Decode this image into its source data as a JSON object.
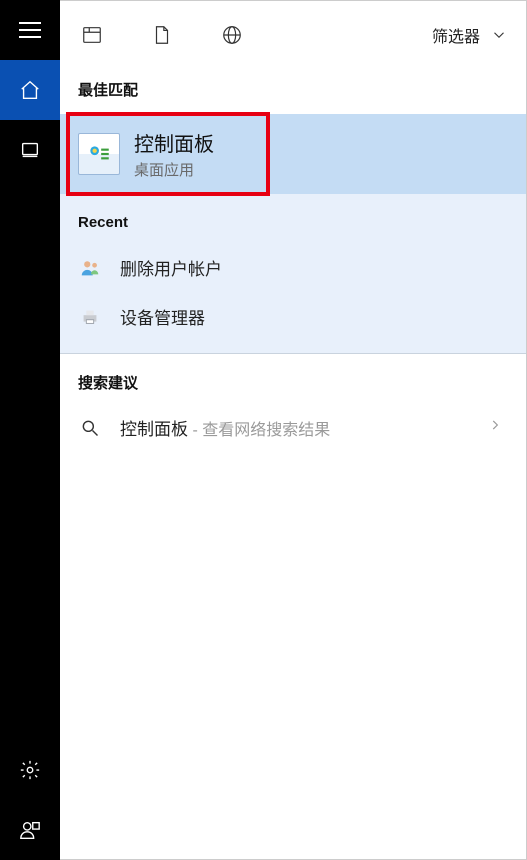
{
  "header": {
    "filter_label": "筛选器"
  },
  "sections": {
    "best_match_title": "最佳匹配",
    "recent_title": "Recent",
    "suggestions_title": "搜索建议"
  },
  "best_match": {
    "title": "控制面板",
    "subtitle": "桌面应用"
  },
  "recent": {
    "items": [
      {
        "label": "删除用户帐户",
        "icon": "users-icon"
      },
      {
        "label": "设备管理器",
        "icon": "printer-icon"
      }
    ]
  },
  "suggestions": {
    "items": [
      {
        "query": "控制面板",
        "hint": " - 查看网络搜索结果"
      }
    ]
  }
}
